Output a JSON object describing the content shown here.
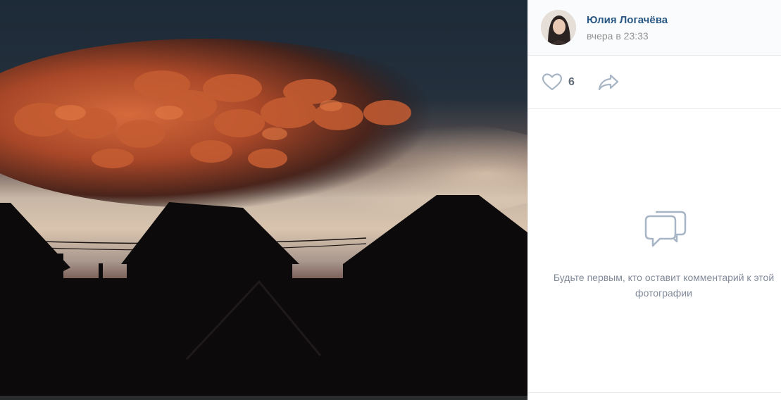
{
  "photo": {
    "description_icon": "photo-sunset-mammatus-clouds"
  },
  "author": {
    "name": "Юлия Логачёва",
    "time": "вчера в 23:33",
    "avatar_icon": "user-avatar"
  },
  "actions": {
    "like_icon": "heart-icon",
    "like_count": "6",
    "share_icon": "share-arrow-icon"
  },
  "comments": {
    "empty_icon": "comments-bubble-icon",
    "empty_text": "Будьте первым, кто оставит комментарий к этой фотографии"
  },
  "colors": {
    "link": "#2a5885",
    "muted": "#939393",
    "icon": "#a8b5c4",
    "border": "#e7e8ec"
  }
}
